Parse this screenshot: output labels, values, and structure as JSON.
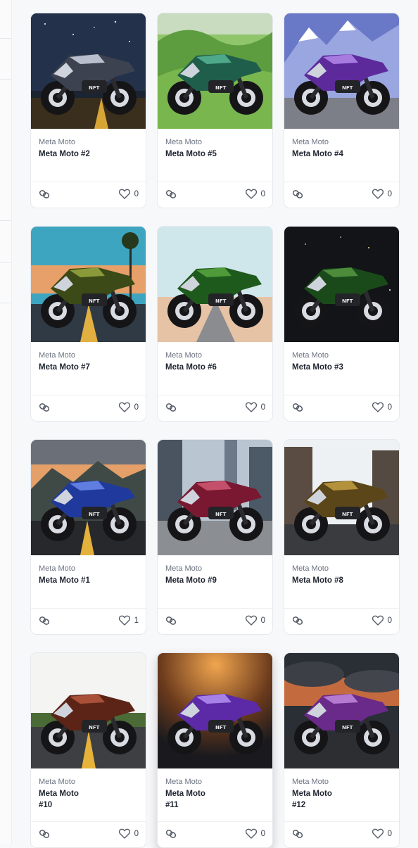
{
  "cards": [
    {
      "collection": "Meta Moto",
      "name": "Meta Moto #2",
      "likes": "0",
      "bike_color": "#3c4250",
      "bike_accent": "#b9bfcc",
      "scene": "night-stars"
    },
    {
      "collection": "Meta Moto",
      "name": "Meta Moto #5",
      "likes": "0",
      "bike_color": "#1f5e4a",
      "bike_accent": "#4ea88a",
      "scene": "green-hills"
    },
    {
      "collection": "Meta Moto",
      "name": "Meta Moto #4",
      "likes": "0",
      "bike_color": "#5d2a9c",
      "bike_accent": "#a77ae0",
      "scene": "mountains"
    },
    {
      "collection": "Meta Moto",
      "name": "Meta Moto #7",
      "likes": "0",
      "bike_color": "#3b4a16",
      "bike_accent": "#8a9a3a",
      "scene": "palm-road"
    },
    {
      "collection": "Meta Moto",
      "name": "Meta Moto #6",
      "likes": "0",
      "bike_color": "#1f5a1d",
      "bike_accent": "#4f9b3a",
      "scene": "sky-road"
    },
    {
      "collection": "Meta Moto",
      "name": "Meta Moto #3",
      "likes": "0",
      "bike_color": "#1b4a1a",
      "bike_accent": "#4c8c3b",
      "scene": "space"
    },
    {
      "collection": "Meta Moto",
      "name": "Meta Moto #1",
      "likes": "1",
      "bike_color": "#1f3a9c",
      "bike_accent": "#5f7ee0",
      "scene": "sunset-mountains"
    },
    {
      "collection": "Meta Moto",
      "name": "Meta Moto #9",
      "likes": "0",
      "bike_color": "#7a1832",
      "bike_accent": "#c44f6a",
      "scene": "city"
    },
    {
      "collection": "Meta Moto",
      "name": "Meta Moto #8",
      "likes": "0",
      "bike_color": "#5a4618",
      "bike_accent": "#b4923b",
      "scene": "old-street"
    },
    {
      "collection": "Meta Moto",
      "name": "Meta Moto #10",
      "likes": "0",
      "bike_color": "#5c2416",
      "bike_accent": "#a85138",
      "scene": "white-road"
    },
    {
      "collection": "Meta Moto",
      "name": "Meta Moto #11",
      "likes": "0",
      "bike_color": "#5c2aa6",
      "bike_accent": "#a681e8",
      "scene": "orange-glow"
    },
    {
      "collection": "Meta Moto",
      "name": "Meta Moto #12",
      "likes": "0",
      "bike_color": "#6a2a8a",
      "bike_accent": "#b47ad0",
      "scene": "cloudy-sunset"
    }
  ],
  "icons": {
    "link": "link-icon",
    "like": "heart-icon"
  }
}
